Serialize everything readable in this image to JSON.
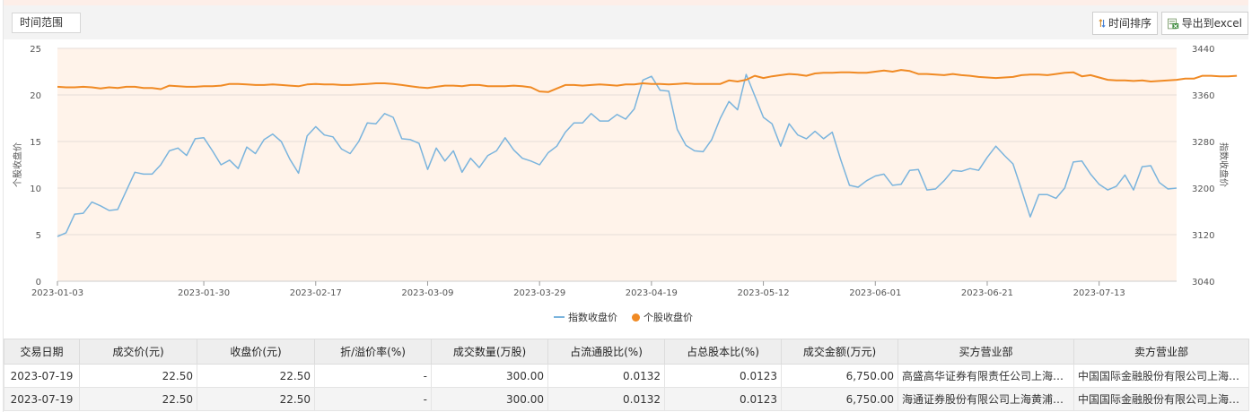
{
  "toolbar": {
    "range_label": "时间范围",
    "sort_label": "时间排序",
    "export_label": "导出到excel"
  },
  "chart_data": {
    "type": "line",
    "x_tick_labels": [
      "2023-01-03",
      "2023-01-30",
      "2023-02-17",
      "2023-03-09",
      "2023-03-29",
      "2023-04-19",
      "2023-05-12",
      "2023-06-01",
      "2023-06-21",
      "2023-07-13"
    ],
    "x_tick_index": [
      0,
      17,
      30,
      43,
      56,
      69,
      82,
      95,
      108,
      121
    ],
    "left_axis": {
      "label": "个股收盘价",
      "range": [
        0,
        25
      ],
      "ticks": [
        0,
        5,
        10,
        15,
        20,
        25
      ]
    },
    "right_axis": {
      "label": "指数收盘价",
      "range": [
        3040,
        3440
      ],
      "ticks": [
        3040,
        3120,
        3200,
        3280,
        3360,
        3440
      ]
    },
    "grid": true,
    "legend_position": "bottom",
    "series": [
      {
        "name": "指数收盘价",
        "axis": "left",
        "color": "#7ab4dd",
        "values": [
          4.8,
          5.2,
          7.2,
          7.3,
          8.5,
          8.1,
          7.6,
          7.7,
          9.7,
          11.7,
          11.5,
          11.5,
          12.5,
          14.0,
          14.3,
          13.5,
          15.3,
          15.4,
          14.0,
          12.5,
          13.0,
          12.1,
          14.4,
          13.7,
          15.2,
          15.8,
          15.0,
          13.1,
          11.6,
          15.6,
          16.6,
          15.7,
          15.5,
          14.2,
          13.7,
          15.0,
          17.0,
          16.9,
          18.0,
          17.6,
          15.3,
          15.2,
          14.8,
          12.0,
          14.3,
          12.9,
          14.0,
          11.7,
          13.2,
          12.2,
          13.5,
          14.0,
          15.4,
          14.1,
          13.2,
          12.9,
          12.5,
          13.8,
          14.5,
          16.0,
          17.0,
          17.0,
          18.0,
          17.2,
          17.2,
          17.9,
          17.4,
          18.5,
          21.6,
          22.0,
          20.5,
          20.4,
          16.3,
          14.6,
          14.0,
          13.9,
          15.2,
          17.5,
          19.3,
          18.4,
          22.2,
          19.9,
          17.6,
          16.9,
          14.5,
          16.9,
          15.7,
          15.3,
          16.1,
          15.3,
          16.0,
          13.0,
          10.3,
          10.1,
          10.8,
          11.3,
          11.5,
          10.3,
          10.4,
          11.9,
          12.0,
          9.8,
          9.9,
          10.8,
          11.9,
          11.8,
          12.1,
          11.9,
          13.3,
          14.5,
          13.5,
          12.6,
          9.8,
          6.9,
          9.3,
          9.3,
          8.9,
          10.0,
          12.8,
          12.9,
          11.5,
          10.4,
          9.8,
          10.2,
          11.4,
          9.8,
          12.3,
          12.4,
          10.6,
          9.9,
          10.0
        ]
      },
      {
        "name": "个股收盘价",
        "axis": "right",
        "color": "#f08a24",
        "values": [
          3374,
          3373,
          3373,
          3374,
          3373,
          3371,
          3373,
          3372,
          3374,
          3374,
          3372,
          3372,
          3370,
          3376,
          3375,
          3374,
          3374,
          3375,
          3375,
          3376,
          3379,
          3379,
          3378,
          3377,
          3377,
          3378,
          3377,
          3376,
          3375,
          3378,
          3379,
          3378,
          3378,
          3377,
          3377,
          3378,
          3379,
          3380,
          3380,
          3379,
          3377,
          3375,
          3373,
          3372,
          3374,
          3376,
          3376,
          3375,
          3377,
          3377,
          3375,
          3375,
          3375,
          3376,
          3375,
          3373,
          3366,
          3365,
          3371,
          3377,
          3377,
          3376,
          3377,
          3378,
          3377,
          3376,
          3378,
          3378,
          3380,
          3379,
          3379,
          3378,
          3379,
          3380,
          3379,
          3379,
          3379,
          3379,
          3385,
          3383,
          3386,
          3393,
          3389,
          3392,
          3394,
          3396,
          3395,
          3393,
          3397,
          3398,
          3398,
          3399,
          3399,
          3398,
          3398,
          3400,
          3402,
          3400,
          3403,
          3401,
          3396,
          3396,
          3395,
          3394,
          3396,
          3394,
          3393,
          3391,
          3390,
          3389,
          3390,
          3391,
          3394,
          3395,
          3395,
          3394,
          3396,
          3398,
          3399,
          3392,
          3394,
          3390,
          3386,
          3385,
          3385,
          3384,
          3385,
          3383,
          3384,
          3385,
          3386,
          3388,
          3388,
          3393,
          3393,
          3392,
          3392,
          3393
        ]
      }
    ]
  },
  "table": {
    "headers": [
      "交易日期",
      "成交价(元)",
      "收盘价(元)",
      "折/溢价率(%)",
      "成交数量(万股)",
      "占流通股比(%)",
      "占总股本比(%)",
      "成交金额(万元)",
      "买方营业部",
      "卖方营业部"
    ],
    "rows": [
      [
        "2023-07-19",
        "22.50",
        "22.50",
        "-",
        "300.00",
        "0.0132",
        "0.0123",
        "6,750.00",
        "高盛高华证券有限责任公司上海…",
        "中国国际金融股份有限公司上海…"
      ],
      [
        "2023-07-19",
        "22.50",
        "22.50",
        "-",
        "300.00",
        "0.0132",
        "0.0123",
        "6,750.00",
        "海通证券股份有限公司上海黄浦…",
        "中国国际金融股份有限公司上海…"
      ]
    ]
  }
}
